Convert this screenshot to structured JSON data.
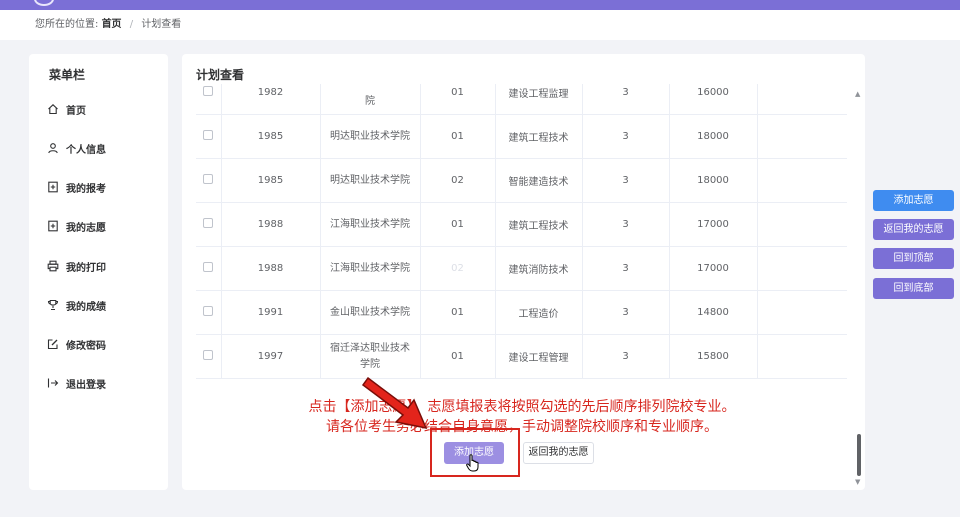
{
  "breadcrumb": {
    "prefix": "您所在的位置:",
    "home": "首页",
    "separator": "/",
    "current": "计划查看"
  },
  "sidebar": {
    "title": "菜单栏",
    "items": [
      {
        "label": "首页",
        "icon": "home-icon"
      },
      {
        "label": "个人信息",
        "icon": "user-icon"
      },
      {
        "label": "我的报考",
        "icon": "document-icon"
      },
      {
        "label": "我的志愿",
        "icon": "document-icon"
      },
      {
        "label": "我的打印",
        "icon": "printer-icon"
      },
      {
        "label": "我的成绩",
        "icon": "trophy-icon"
      },
      {
        "label": "修改密码",
        "icon": "edit-icon"
      },
      {
        "label": "退出登录",
        "icon": "logout-icon"
      }
    ]
  },
  "main": {
    "title": "计划查看",
    "rows": [
      {
        "code": "1982",
        "school": "院",
        "major_code": "01",
        "major": "建设工程监理",
        "years": "3",
        "fee": "16000"
      },
      {
        "code": "1985",
        "school": "明达职业技术学院",
        "major_code": "01",
        "major": "建筑工程技术",
        "years": "3",
        "fee": "18000"
      },
      {
        "code": "1985",
        "school": "明达职业技术学院",
        "major_code": "02",
        "major": "智能建造技术",
        "years": "3",
        "fee": "18000"
      },
      {
        "code": "1988",
        "school": "江海职业技术学院",
        "major_code": "01",
        "major": "建筑工程技术",
        "years": "3",
        "fee": "17000"
      },
      {
        "code": "1988",
        "school": "江海职业技术学院",
        "major_code": "02",
        "major": "建筑消防技术",
        "years": "3",
        "fee": "17000"
      },
      {
        "code": "1991",
        "school": "金山职业技术学院",
        "major_code": "01",
        "major": "工程造价",
        "years": "3",
        "fee": "14800"
      },
      {
        "code": "1997",
        "school": "宿迁泽达职业技术学院",
        "major_code": "01",
        "major": "建设工程管理",
        "years": "3",
        "fee": "15800"
      }
    ],
    "notice_line1": "点击【添加志愿】，志愿填报表将按照勾选的先后顺序排列院校专业。",
    "notice_line2": "请各位考生务必结合自身意愿，手动调整院校顺序和专业顺序。",
    "add_button": "添加志愿",
    "back_button": "返回我的志愿"
  },
  "side_buttons": [
    {
      "label": "添加志愿",
      "color": "#3f8cf0"
    },
    {
      "label": "返回我的志愿",
      "color": "#7b6fd6"
    },
    {
      "label": "回到顶部",
      "color": "#7b6fd6"
    },
    {
      "label": "回到底部",
      "color": "#7b6fd6"
    }
  ],
  "colors": {
    "accent": "#7b6fd6",
    "primary_blue": "#3f8cf0",
    "highlight_red": "#d7261e",
    "add_button_bg": "#9c8fe2"
  }
}
